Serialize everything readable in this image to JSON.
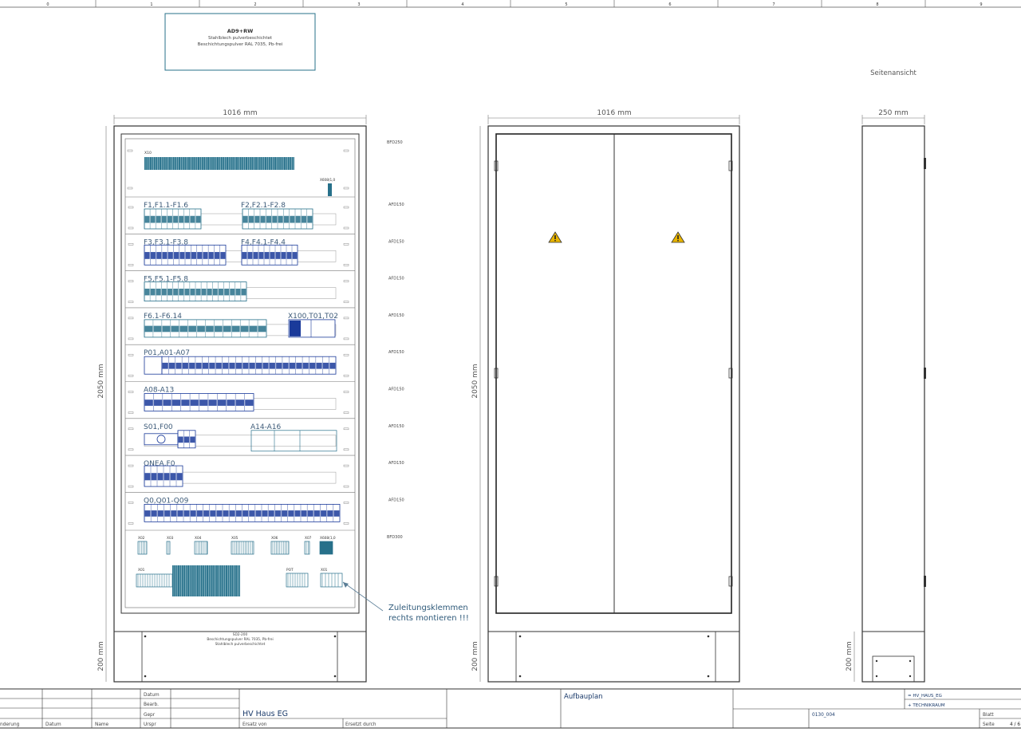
{
  "grid": {
    "columns": [
      "0",
      "1",
      "2",
      "3",
      "4",
      "5",
      "6",
      "7",
      "8",
      "9"
    ]
  },
  "material_box": {
    "code": "AD9+RW",
    "line1": "Stahlblech pulverbeschichtet",
    "line2": "Beschichtungspulver RAL 7035, Pb-frei"
  },
  "side_view_label": "Seitenansicht",
  "dimensions": {
    "front_width": "1016 mm",
    "door_width": "1016 mm",
    "side_width": "250 mm",
    "height": "2050 mm",
    "plinth_height": "200 mm"
  },
  "panel": {
    "rows": [
      {
        "label": "X10",
        "label2": "X608(1,0",
        "duct": "BFD250"
      },
      {
        "label": "F1,F1.1-F1.6",
        "label2": "F2,F2.1-F2.8",
        "duct": "AFD150"
      },
      {
        "label": "F3,F3.1-F3.8",
        "label2": "F4,F4.1-F4.4",
        "duct": "AFD150"
      },
      {
        "label": "F5,F5.1-F5.8",
        "label2": "",
        "duct": "AFD150"
      },
      {
        "label": "F6.1-F6.14",
        "label2": "X100,T01,T02",
        "duct": "AFD150"
      },
      {
        "label": "P01,A01-A07",
        "label2": "",
        "duct": "AFD150"
      },
      {
        "label": "A08-A13",
        "label2": "",
        "duct": "AFD150"
      },
      {
        "label": "S01,F00",
        "label2": "A14-A16",
        "duct": "AFD150"
      },
      {
        "label": "QNEA,F0",
        "label2": "",
        "duct": "AFD150"
      },
      {
        "label": "Q0,Q01-Q09",
        "label2": "",
        "duct": "AFD150"
      }
    ],
    "terminal_row": {
      "labels": [
        "X02",
        "X03",
        "X04",
        "X05",
        "X06",
        "X07",
        "X608(1,0"
      ],
      "duct": "BFD300"
    },
    "bottom_labels": [
      "X01",
      "POT",
      "X01"
    ],
    "note_line1": "Zuleitungsklemmen",
    "note_line2": "rechts montieren !!!",
    "plinth_line1": "SD2-200",
    "plinth_line2": "Beschichtungspulver RAL 7035, Pb-frei",
    "plinth_line3": "Stahlblech pulverbeschichtet"
  },
  "title_block": {
    "row_labels": [
      "Datum",
      "Bearb.",
      "Gepr",
      "Urspr"
    ],
    "rev_cols": [
      "nderung",
      "Datum",
      "Name"
    ],
    "project": "HV Haus EG",
    "ersatz_von": "Ersatz von",
    "ersetzt_durch": "Ersetzt durch",
    "sheet_title": "Aufbauplan",
    "drawing_no": "0130_004",
    "function": "= HV_HAUS_EG",
    "location": "+ TECHNIKRAUM",
    "blatt": "Blatt",
    "seite": "Seite",
    "page": "4 / 6"
  },
  "colors": {
    "frame": "#3c3c3c",
    "text": "#444444",
    "component_blue": "#1a3a9a",
    "component_teal": "#27708a",
    "warning_yellow": "#e8b400",
    "note_text": "#2f5a7a"
  }
}
